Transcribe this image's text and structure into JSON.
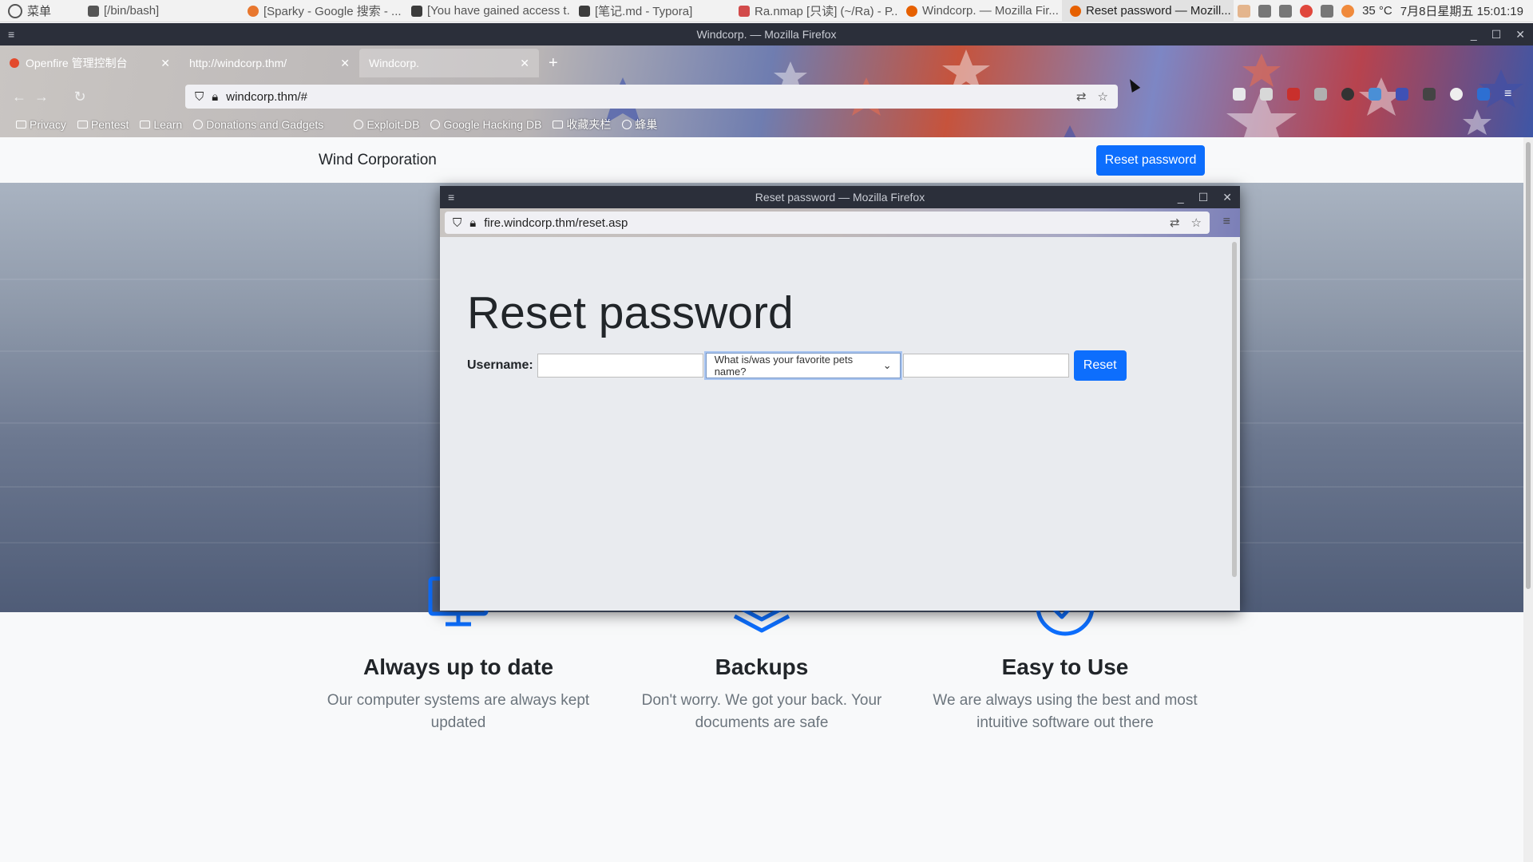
{
  "taskbar": {
    "menu_label": "菜单",
    "tasks": [
      {
        "label": "[/bin/bash]",
        "color": "#555555"
      },
      {
        "label": "[Sparky - Google 搜索 - ...",
        "color": "#e8772e"
      },
      {
        "label": "[You have gained access t...",
        "color": "#3c3c3c"
      },
      {
        "label": "[笔记.md - Typora]",
        "color": "#3c3c3c"
      },
      {
        "label": "Ra.nmap [只读] (~/Ra) - P...",
        "color": "#d24b4b"
      },
      {
        "label": "Windcorp. — Mozilla Fir...",
        "color": "#e66000"
      },
      {
        "label": "Reset password — Mozill...",
        "color": "#e66000"
      }
    ],
    "weather": "35 °C",
    "clock": "7月8日星期五 15:01:19"
  },
  "window": {
    "title": "Windcorp. — Mozilla Firefox"
  },
  "browser": {
    "tabs": [
      {
        "label": "Openfire 管理控制台"
      },
      {
        "label": "http://windcorp.thm/"
      },
      {
        "label": "Windcorp."
      }
    ],
    "url": "windcorp.thm/#",
    "bookmarks": [
      {
        "label": "Privacy",
        "type": "folder"
      },
      {
        "label": "Pentest",
        "type": "folder"
      },
      {
        "label": "Learn",
        "type": "folder"
      },
      {
        "label": "Donations and Gadgets",
        "type": "site"
      },
      {
        "label": "Exploit-DB",
        "type": "site"
      },
      {
        "label": "Google Hacking DB",
        "type": "site"
      },
      {
        "label": "收藏夹栏",
        "type": "folder"
      },
      {
        "label": "蜂巢",
        "type": "site"
      }
    ]
  },
  "site": {
    "brand": "Wind Corporation",
    "header_button": "Reset password",
    "features": [
      {
        "icon": "monitor-icon",
        "title": "Always up to date",
        "text": "Our computer systems are always kept updated"
      },
      {
        "icon": "layers-icon",
        "title": "Backups",
        "text": "Don't worry. We got your back. Your documents are safe"
      },
      {
        "icon": "check-circle-icon",
        "title": "Easy to Use",
        "text": "We are always using the best and most intuitive software out there"
      }
    ]
  },
  "popup": {
    "title": "Reset password — Mozilla Firefox",
    "url": "fire.windcorp.thm/reset.asp",
    "heading": "Reset password",
    "username_label": "Username:",
    "username_value": "",
    "question_selected": "What is/was your favorite pets name?",
    "answer_value": "",
    "reset_button": "Reset"
  },
  "colors": {
    "primary": "#0d6efd",
    "titlebar": "#2b2f3a"
  }
}
